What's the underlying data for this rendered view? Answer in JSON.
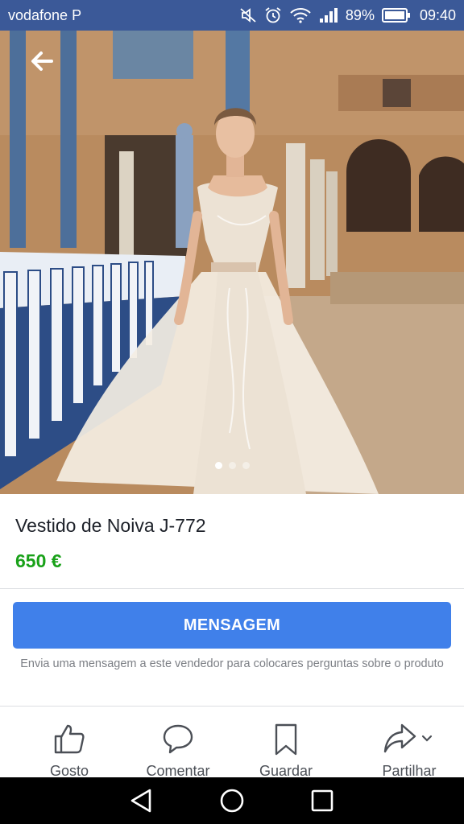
{
  "status_bar": {
    "carrier": "vodafone P",
    "battery": "89%",
    "time": "09:40"
  },
  "hero": {
    "image_indicator": {
      "count": 3,
      "active_index": 0
    }
  },
  "product": {
    "title": "Vestido de Noiva J-772",
    "price": "650 €"
  },
  "message": {
    "button_label": "MENSAGEM",
    "hint": "Envia uma mensagem a este vendedor para colocares perguntas sobre o produto"
  },
  "actions": [
    {
      "label": "Gosto",
      "icon": "like-icon"
    },
    {
      "label": "Comentar",
      "icon": "comment-icon"
    },
    {
      "label": "Guardar",
      "icon": "bookmark-icon"
    },
    {
      "label": "Partilhar",
      "icon": "share-icon"
    }
  ],
  "colors": {
    "status_bar": "#3b5998",
    "button": "#4080ea",
    "price": "#19a119"
  }
}
